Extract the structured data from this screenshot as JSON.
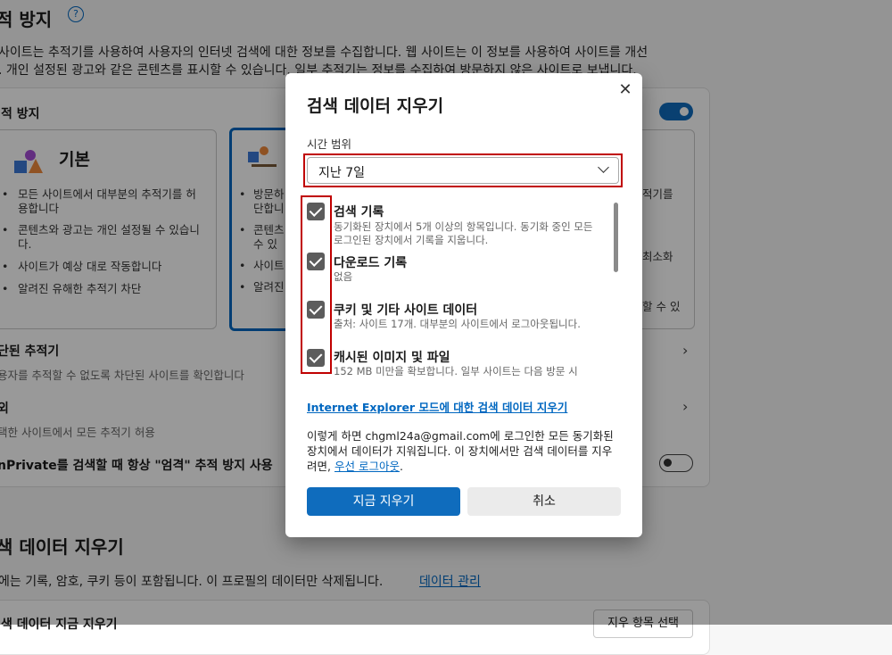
{
  "background": {
    "section_title": "적 방지",
    "help_icon": "?",
    "intro_line1": "사이트는 추적기를 사용하여 사용자의 인터넷 검색에 대한 정보를 수집합니다. 웹 사이트는 이 정보를 사용하여 사이트를 개선",
    "intro_line2": ". 개인 설정된 광고와 같은 콘텐츠를 표시할 수 있습니다. 일부 추적기는 정보를 수집하여 방문하지 않은 사이트로 보냅니다.",
    "card_title": "적 방지",
    "basic": {
      "title": "기본",
      "bullets": [
        "모든 사이트에서 대부분의 추적기를 허용합니다",
        "콘텐츠와 광고는 개인 설정될 수 있습니다.",
        "사이트가 예상 대로 작동합니다",
        "알려진 유해한 추적기 차단"
      ]
    },
    "balanced_frag": {
      "bullets": [
        "방문하",
        "단합니",
        "콘텐츠",
        "수 있",
        "사이트",
        "알려진"
      ]
    },
    "strict_frag": {
      "lines": [
        "적기를",
        "최소화",
        "할 수 있"
      ]
    },
    "blocked_title": "단된 추적기",
    "blocked_desc": "용자를 추적할 수 없도록 차단된 사이트를 확인합니다",
    "exceptions_title": "외",
    "exceptions_desc": "택한 사이트에서 모든 추적기 허용",
    "inprivate_label": "nPrivate를 검색할 때 항상 \"엄격\" 추적 방지 사용",
    "clear_title": "색 데이터 지우기",
    "clear_desc": "에는 기록, 암호, 쿠키 등이 포함됩니다. 이 프로필의 데이터만 삭제됩니다.",
    "clear_link": "데이터 관리",
    "clear_now_frag": "색 데이터 지금 지우기",
    "choose_btn_frag": "지우 항목 선택"
  },
  "dialog": {
    "title": "검색 데이터 지우기",
    "close_icon": "✕",
    "time_range_label": "시간 범위",
    "time_range_value": "지난 7일",
    "items": [
      {
        "title": "검색 기록",
        "desc": "동기화된 장치에서 5개 이상의 항목입니다. 동기화 중인 모든 로그인된 장치에서 기록을 지웁니다.",
        "checked": true
      },
      {
        "title": "다운로드 기록",
        "desc": "없음",
        "checked": true
      },
      {
        "title": "쿠키 및 기타 사이트 데이터",
        "desc": "출처: 사이트 17개. 대부분의 사이트에서 로그아웃됩니다.",
        "checked": true
      },
      {
        "title": "캐시된 이미지 및 파일",
        "desc": "152 MB 미만을 확보합니다. 일부 사이트는 다음 방문 시",
        "checked": true
      }
    ],
    "ie_link": "Internet Explorer 모드에 대한 검색 데이터 지우기",
    "note_text": "이렇게 하면 chgml24a@gmail.com에 로그인한 모든 동기화된 장치에서 데이터가 지워집니다. 이 장치에서만 검색 데이터를 지우려면,",
    "note_link": "우선 로그아웃",
    "note_end": ".",
    "clear_button": "지금 지우기",
    "cancel_button": "취소"
  },
  "colors": {
    "accent": "#0f6cbd",
    "highlight_box": "#c00000"
  }
}
